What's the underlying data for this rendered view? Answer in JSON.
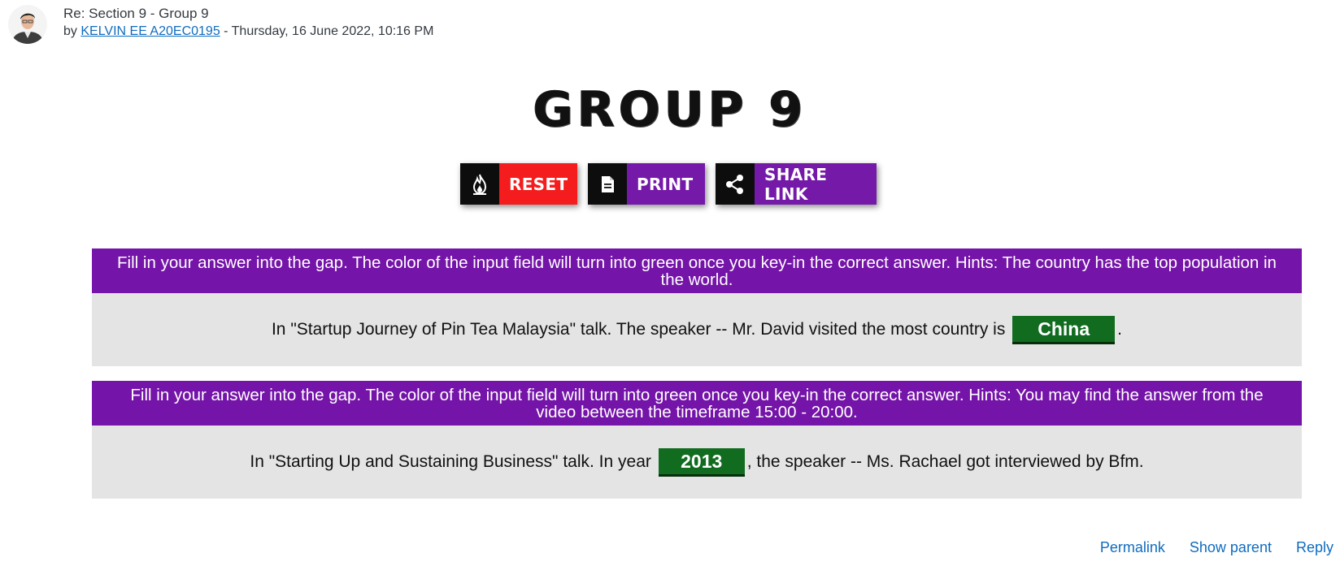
{
  "post": {
    "subject": "Re: Section 9 - Group 9",
    "by_prefix": "by ",
    "author": "KELVIN EE A20EC0195",
    "date_text": " - Thursday, 16 June 2022, 10:16 PM"
  },
  "game": {
    "title": "GROUP 9",
    "toolbar": {
      "reset_label": "RESET",
      "print_label": "PRINT",
      "share_label": "SHARE LINK"
    },
    "tasks": [
      {
        "hint": "Fill in your answer into the gap. The color of the input field will turn into green once you key-in the correct answer. Hints: The country has the top population in the world.",
        "before": "In \"Startup Journey of Pin Tea Malaysia\" talk. The speaker -- Mr. David visited the most country is ",
        "answer": "China",
        "after": "."
      },
      {
        "hint": "Fill in your answer into the gap. The color of the input field will turn into green once you key-in the correct answer. Hints: You may find the answer from the video between the timeframe 15:00 - 20:00.",
        "before": "In \"Starting Up and Sustaining Business\" talk. In year ",
        "answer": "2013",
        "after": ", the speaker -- Ms. Rachael got interviewed by Bfm."
      }
    ],
    "colors": {
      "accent_purple": "#7414a8",
      "reset_red": "#f41c1c",
      "correct_green": "#116c1f"
    }
  },
  "actions": {
    "permalink": "Permalink",
    "show_parent": "Show parent",
    "reply": "Reply"
  }
}
